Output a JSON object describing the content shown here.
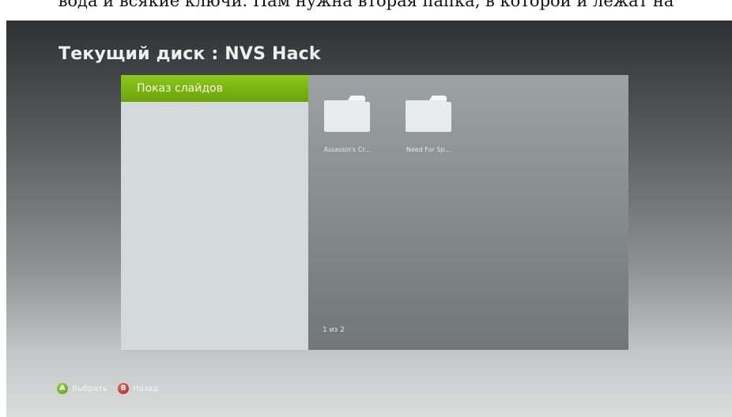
{
  "caption": "вода и всякие ключи. Нам нужна вторая папка, в которой и лежат на",
  "screen": {
    "title": "Текущий диск : NVS Hack"
  },
  "menu": {
    "items": [
      {
        "label": "Показ слайдов",
        "selected": true
      }
    ]
  },
  "content": {
    "folders": [
      {
        "label": "Assassin's Cr...",
        "icon": "folder-icon"
      },
      {
        "label": "Need For Sp...",
        "icon": "folder-icon"
      }
    ],
    "page_indicator": "1 из 2"
  },
  "hints": [
    {
      "button": "A",
      "label": "Выбрать",
      "color": "#5fb31f"
    },
    {
      "button": "B",
      "label": "Назад",
      "color": "#c12a2a"
    }
  ],
  "colors": {
    "accent_green": "#7ab317",
    "left_panel": "#d4d9db",
    "right_panel": "#868b8d"
  }
}
